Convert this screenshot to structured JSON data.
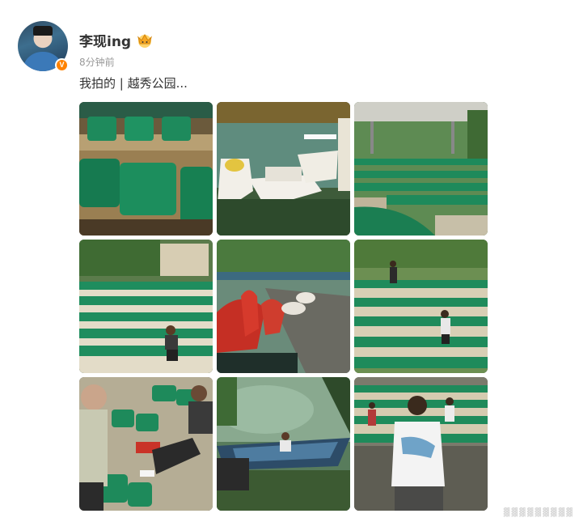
{
  "post": {
    "username": "李现ing",
    "time": "8分钟前",
    "content": "我拍的 | 越秀公园...",
    "verified_badge": "V",
    "crown_icon": "crown-icon",
    "colors": {
      "accent": "#ff8200",
      "seat_green": "#1f8a5b",
      "text": "#333333",
      "muted": "#999999"
    }
  },
  "photos": [
    {
      "name": "photo-green-seats-closeup",
      "icon": "image"
    },
    {
      "name": "photo-paddle-boats",
      "icon": "image"
    },
    {
      "name": "photo-stadium-stands",
      "icon": "image"
    },
    {
      "name": "photo-man-sitting-stands",
      "icon": "image"
    },
    {
      "name": "photo-swan-boats",
      "icon": "image"
    },
    {
      "name": "photo-stands-people",
      "icon": "image"
    },
    {
      "name": "photo-old-man-seats",
      "icon": "image"
    },
    {
      "name": "photo-rowboat-lake",
      "icon": "image"
    },
    {
      "name": "photo-boy-white-shirt",
      "icon": "image"
    }
  ]
}
